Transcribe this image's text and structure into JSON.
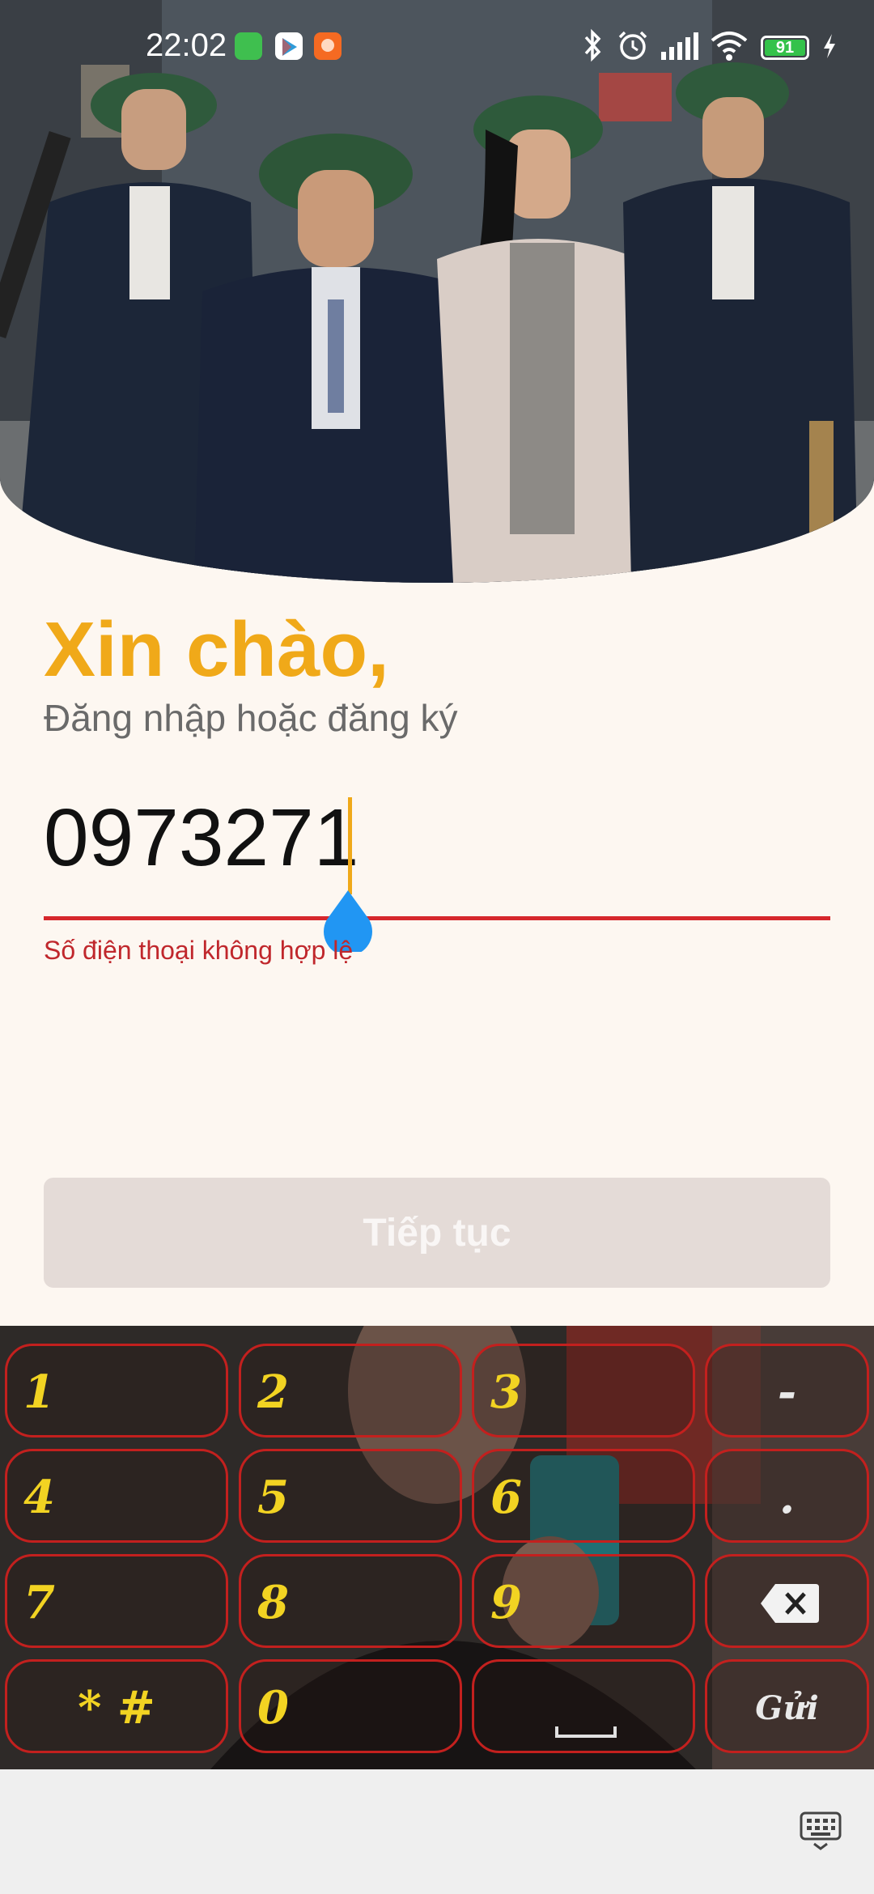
{
  "status_bar": {
    "time": "22:02",
    "battery": "91",
    "icons": [
      "bluetooth-icon",
      "alarm-icon",
      "signal-icon",
      "wifi-icon",
      "charging-icon"
    ],
    "app_icons": [
      "android-app-icon",
      "play-store-icon",
      "shopee-app-icon"
    ]
  },
  "login": {
    "greeting": "Xin chào,",
    "subtitle": "Đăng nhập hoặc đăng ký",
    "phone_value": "0973271",
    "error": "Số điện thoại không hợp lệ",
    "continue_label": "Tiếp tục"
  },
  "keyboard": {
    "keys": [
      {
        "label": "1"
      },
      {
        "label": "2"
      },
      {
        "label": "3"
      },
      {
        "label": "-"
      },
      {
        "label": "4"
      },
      {
        "label": "5"
      },
      {
        "label": "6"
      },
      {
        "label": "."
      },
      {
        "label": "7"
      },
      {
        "label": "8"
      },
      {
        "label": "9"
      },
      {
        "label": "⌫"
      },
      {
        "label": "* #"
      },
      {
        "label": "0"
      },
      {
        "label": "␣"
      },
      {
        "label": "Gửi"
      }
    ]
  },
  "colors": {
    "accent": "#f0a919",
    "error": "#d6272c",
    "key_text": "#f2d322",
    "key_border": "#c3201e",
    "caret_handle": "#2196f3"
  }
}
